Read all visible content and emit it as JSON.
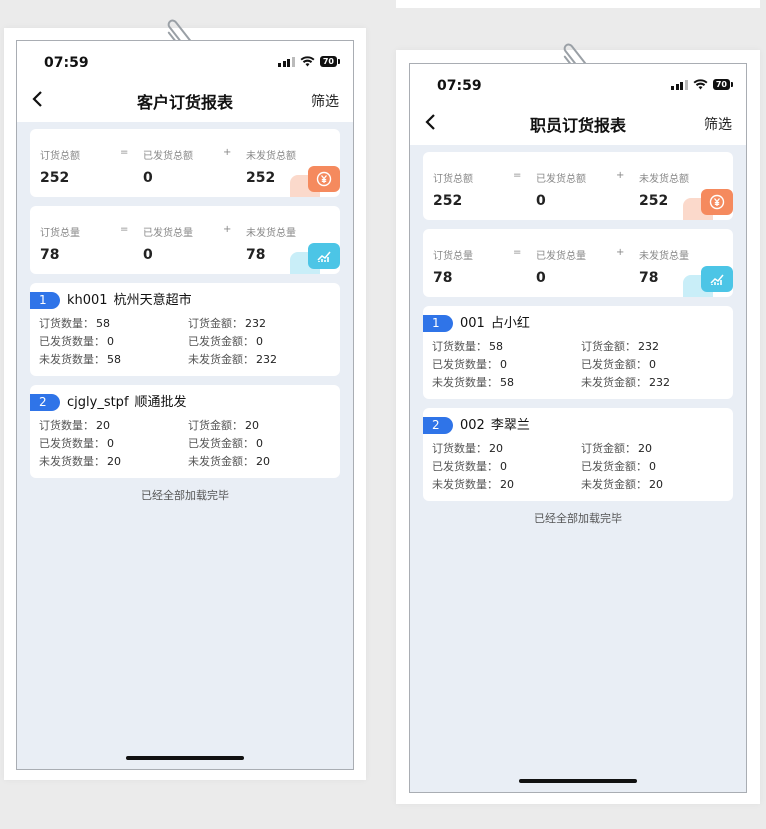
{
  "colors": {
    "accent_blue": "#2f74e8",
    "orange": "#f58a5e",
    "cyan": "#4cc5e6",
    "screen_bg": "#e9eef5"
  },
  "status": {
    "time": "07:59",
    "battery": "70"
  },
  "left": {
    "title": "客户订货报表",
    "filter": "筛选",
    "summary_amount": {
      "labels": [
        "订货总额",
        "=",
        "已发货总额",
        "+",
        "未发货总额"
      ],
      "values": [
        "252",
        "0",
        "252"
      ],
      "icon": "yen-icon"
    },
    "summary_qty": {
      "labels": [
        "订货总量",
        "=",
        "已发货总量",
        "+",
        "未发货总量"
      ],
      "values": [
        "78",
        "0",
        "78"
      ],
      "icon": "trend-chart-icon"
    },
    "items": [
      {
        "index": "1",
        "code": "kh001",
        "name": "杭州天意超市",
        "fields": [
          {
            "k": "订货数量：",
            "v": "58"
          },
          {
            "k": "订货金额：",
            "v": "232"
          },
          {
            "k": "已发货数量：",
            "v": "0"
          },
          {
            "k": "已发货金额：",
            "v": "0"
          },
          {
            "k": "未发货数量：",
            "v": "58"
          },
          {
            "k": "未发货金额：",
            "v": "232"
          }
        ]
      },
      {
        "index": "2",
        "code": "cjgly_stpf",
        "name": "顺通批发",
        "fields": [
          {
            "k": "订货数量：",
            "v": "20"
          },
          {
            "k": "订货金额：",
            "v": "20"
          },
          {
            "k": "已发货数量：",
            "v": "0"
          },
          {
            "k": "已发货金额：",
            "v": "0"
          },
          {
            "k": "未发货数量：",
            "v": "20"
          },
          {
            "k": "未发货金额：",
            "v": "20"
          }
        ]
      }
    ],
    "end_text": "已经全部加载完毕"
  },
  "right": {
    "title": "职员订货报表",
    "filter": "筛选",
    "summary_amount": {
      "labels": [
        "订货总额",
        "=",
        "已发货总额",
        "+",
        "未发货总额"
      ],
      "values": [
        "252",
        "0",
        "252"
      ],
      "icon": "yen-icon"
    },
    "summary_qty": {
      "labels": [
        "订货总量",
        "=",
        "已发货总量",
        "+",
        "未发货总量"
      ],
      "values": [
        "78",
        "0",
        "78"
      ],
      "icon": "trend-chart-icon"
    },
    "items": [
      {
        "index": "1",
        "code": "001",
        "name": "占小红",
        "fields": [
          {
            "k": "订货数量：",
            "v": "58"
          },
          {
            "k": "订货金额：",
            "v": "232"
          },
          {
            "k": "已发货数量：",
            "v": "0"
          },
          {
            "k": "已发货金额：",
            "v": "0"
          },
          {
            "k": "未发货数量：",
            "v": "58"
          },
          {
            "k": "未发货金额：",
            "v": "232"
          }
        ]
      },
      {
        "index": "2",
        "code": "002",
        "name": "李翠兰",
        "fields": [
          {
            "k": "订货数量：",
            "v": "20"
          },
          {
            "k": "订货金额：",
            "v": "20"
          },
          {
            "k": "已发货数量：",
            "v": "0"
          },
          {
            "k": "已发货金额：",
            "v": "0"
          },
          {
            "k": "未发货数量：",
            "v": "20"
          },
          {
            "k": "未发货金额：",
            "v": "20"
          }
        ]
      }
    ],
    "end_text": "已经全部加载完毕"
  }
}
